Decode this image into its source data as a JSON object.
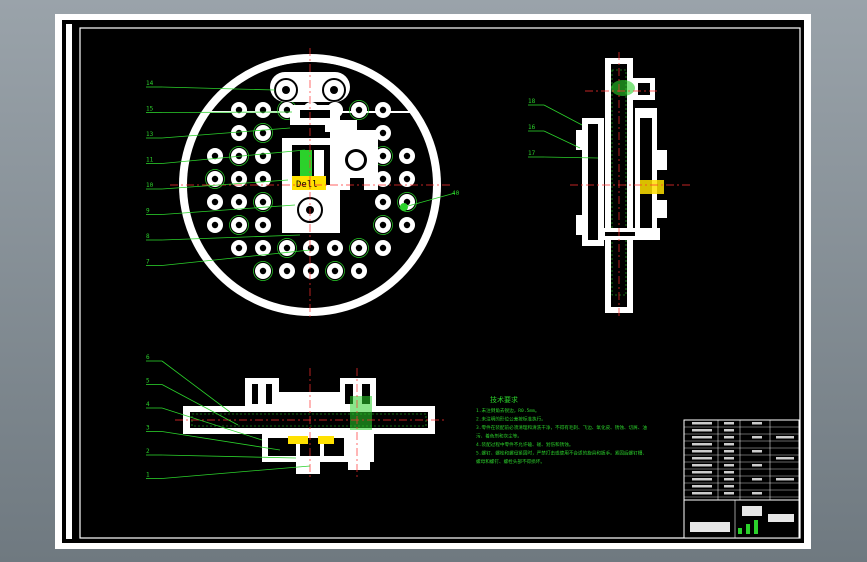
{
  "drawing": {
    "colors": {
      "paper": "#ffffff",
      "background": "#000000",
      "part": "#ffffff",
      "leader": "#2bd12b",
      "centerline": "#ff3030",
      "highlight": "#ffe100",
      "hatch": "#2bd12b"
    },
    "top_view_callouts": [
      "14",
      "15",
      "13",
      "11",
      "10",
      "9",
      "8",
      "7"
    ],
    "side_view_callouts": [
      "18",
      "16",
      "17"
    ],
    "front_view_callouts": [
      "6",
      "5",
      "4",
      "3",
      "2",
      "1"
    ],
    "ball_label": "40",
    "tech_requirements": {
      "title": "技术要求",
      "lines": [
        "1.未注倒角去锐边，R0.5mm。",
        "2.未注明的形位公差按标准执行。",
        "3.零件在装配前必须清理和清洗干净，不得有毛刺、飞边、氧化皮、锈蚀、切屑、油",
        "污、着色剂和灰尘等。",
        "4.装配过程中零件不允许磕、碰、划伤和锈蚀。",
        "5.螺钉、螺栓和螺母紧固时，严禁打击或使用不合适的旋具和扳手。紧固后螺钉槽、",
        "螺母和螺钉、螺栓头部不得损坏。"
      ]
    }
  }
}
